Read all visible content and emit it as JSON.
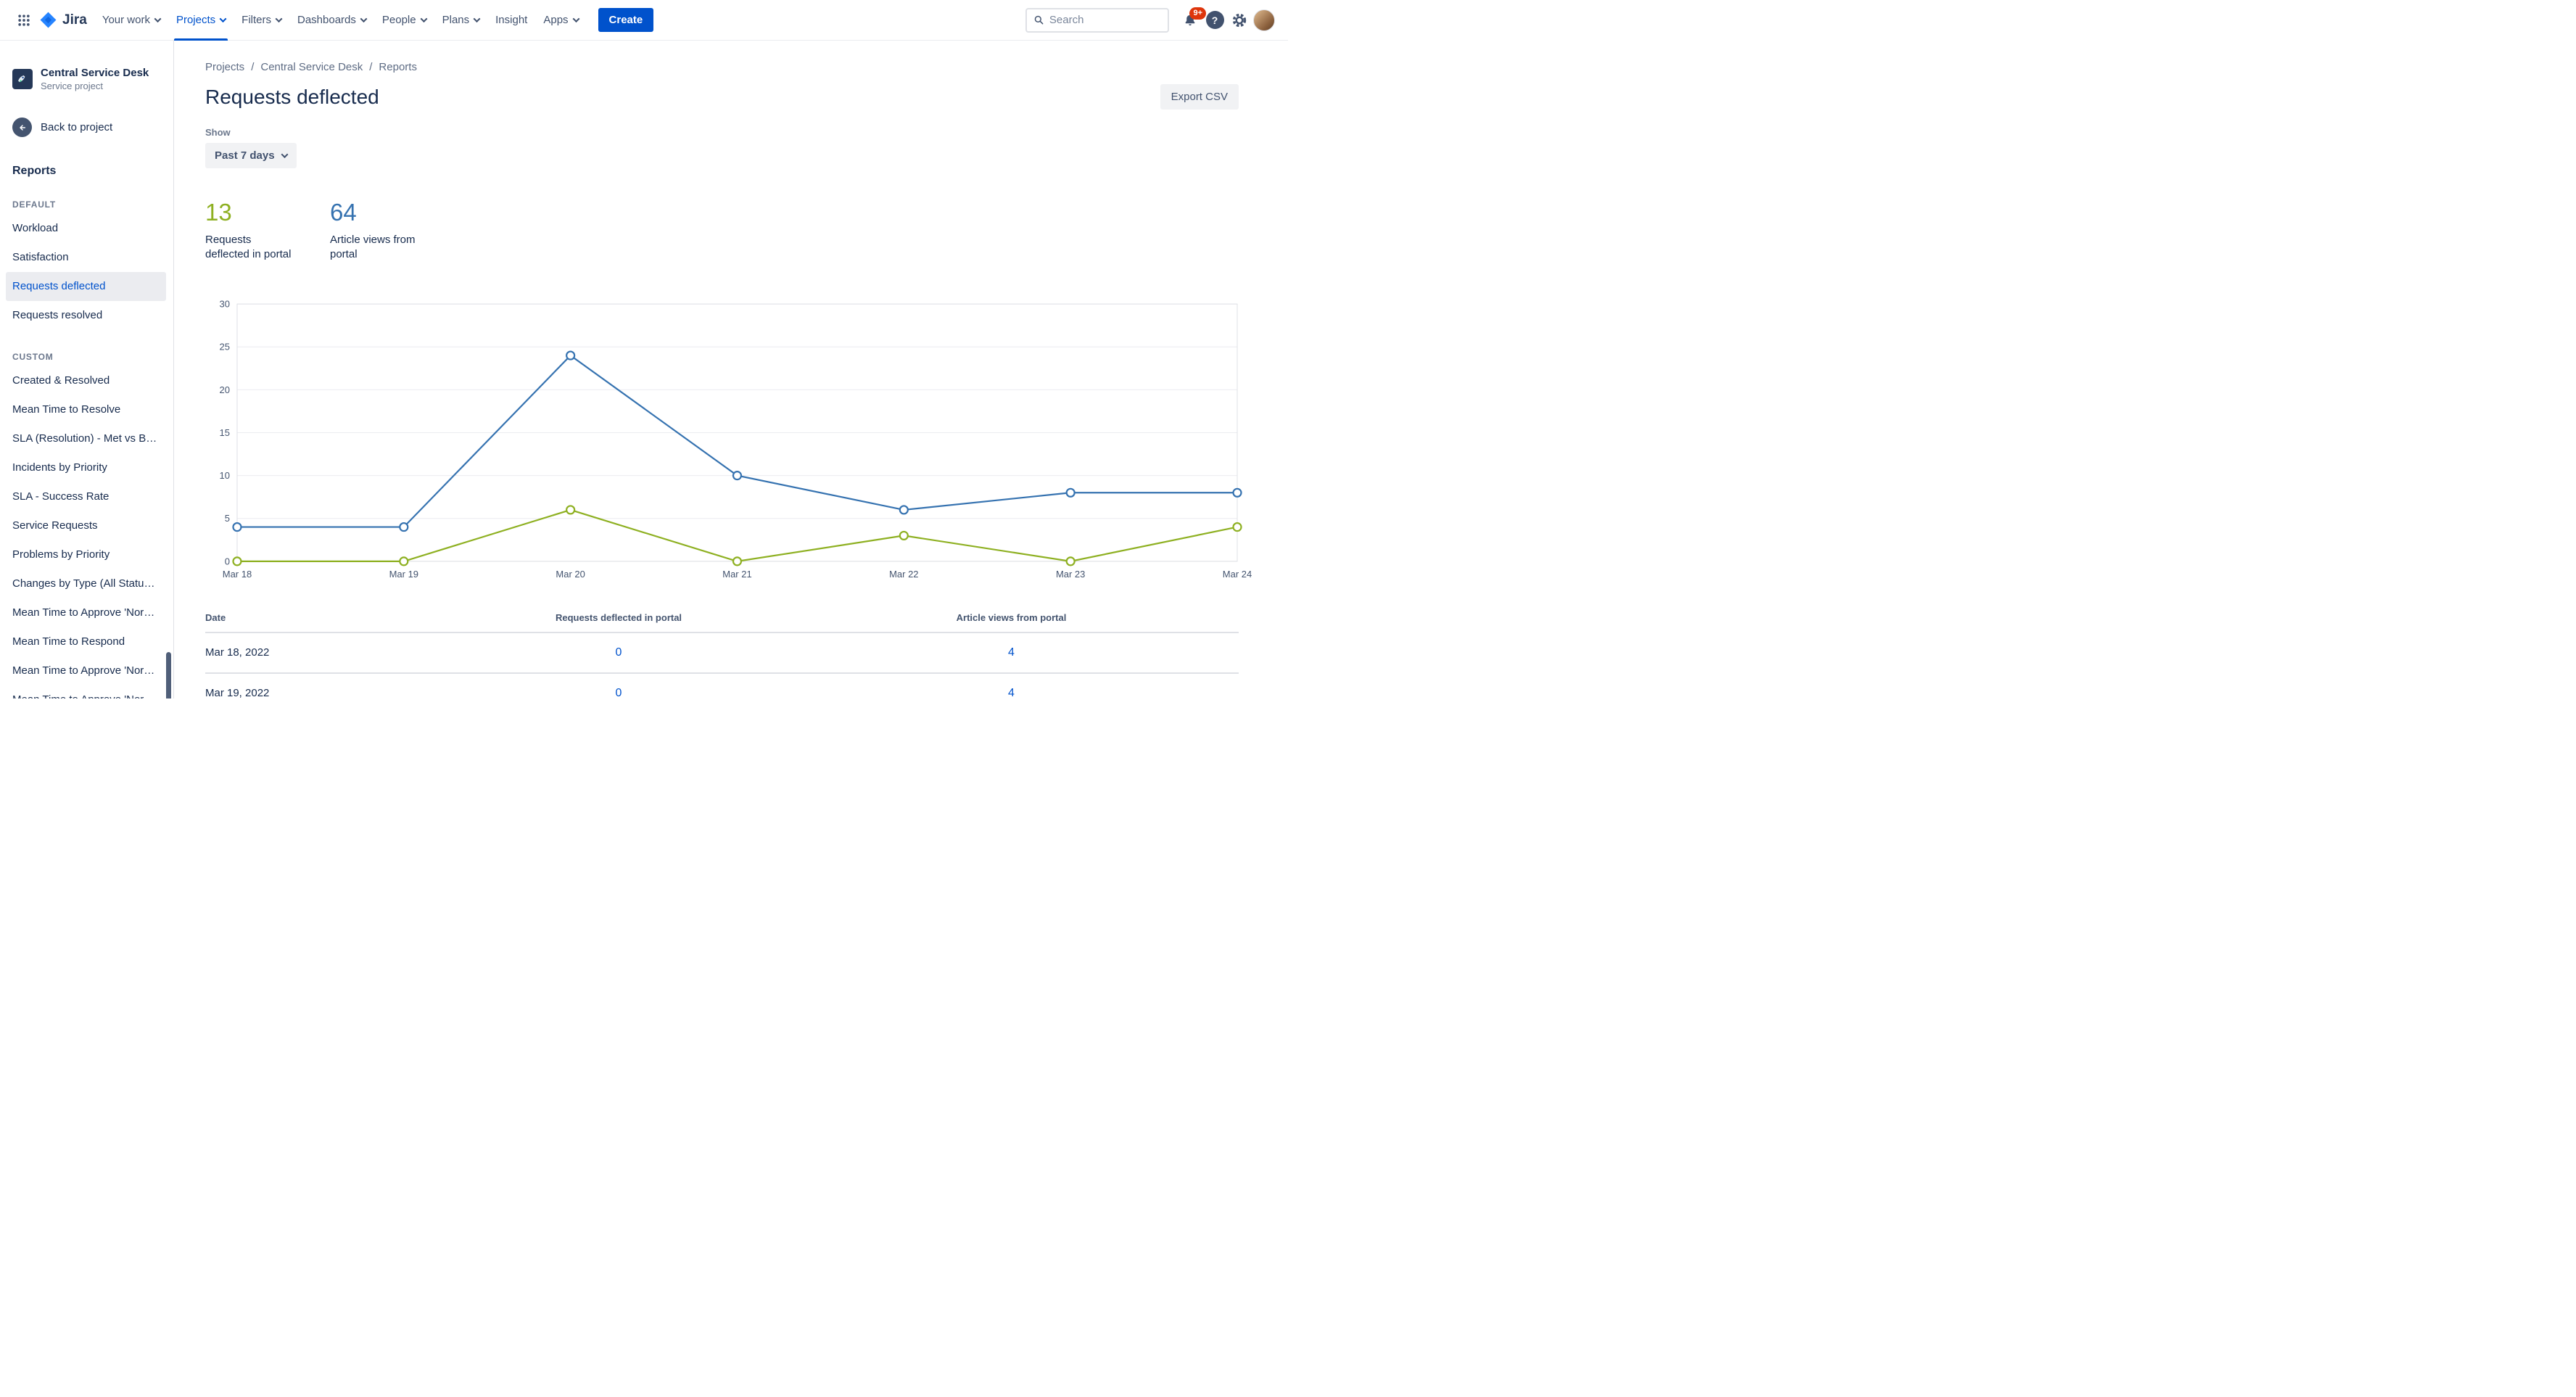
{
  "colors": {
    "link_blue": "#0052CC",
    "accent_green": "#8EB021",
    "accent_blue": "#3572B0",
    "badge_red": "#DE350B"
  },
  "topnav": {
    "brand": "Jira",
    "items": [
      {
        "label": "Your work"
      },
      {
        "label": "Projects"
      },
      {
        "label": "Filters"
      },
      {
        "label": "Dashboards"
      },
      {
        "label": "People"
      },
      {
        "label": "Plans"
      },
      {
        "label": "Insight"
      },
      {
        "label": "Apps"
      }
    ],
    "create_label": "Create",
    "search_placeholder": "Search",
    "notifications_badge": "9+"
  },
  "sidebar": {
    "project_name": "Central Service Desk",
    "project_type": "Service project",
    "back_label": "Back to project",
    "heading": "Reports",
    "groups": [
      {
        "title": "DEFAULT",
        "items": [
          "Workload",
          "Satisfaction",
          "Requests deflected",
          "Requests resolved"
        ]
      },
      {
        "title": "CUSTOM",
        "items": [
          "Created & Resolved",
          "Mean Time to Resolve",
          "SLA (Resolution) - Met vs Bre…",
          "Incidents by Priority",
          "SLA - Success Rate",
          "Service Requests",
          "Problems by Priority",
          "Changes by Type (All Statuses)",
          "Mean Time to Approve 'Norm…",
          "Mean Time to Respond",
          "Mean Time to Approve 'Norm…",
          "Mean Time to Approve 'Norm…"
        ]
      }
    ]
  },
  "breadcrumb": {
    "items": [
      "Projects",
      "Central Service Desk",
      "Reports"
    ],
    "separator": "/"
  },
  "page": {
    "title": "Requests deflected",
    "export_label": "Export CSV",
    "show_label": "Show",
    "range_value": "Past 7 days"
  },
  "stats": [
    {
      "value": "13",
      "label": "Requests deflected in portal",
      "color": "#8EB021"
    },
    {
      "value": "64",
      "label": "Article views from portal",
      "color": "#3572B0"
    }
  ],
  "chart_data": {
    "type": "line",
    "x": [
      "Mar 18",
      "Mar 19",
      "Mar 20",
      "Mar 21",
      "Mar 22",
      "Mar 23",
      "Mar 24"
    ],
    "series": [
      {
        "name": "Article views from portal",
        "color": "#3572B0",
        "values": [
          4,
          4,
          24,
          10,
          6,
          8,
          8
        ]
      },
      {
        "name": "Requests deflected in portal",
        "color": "#8EB021",
        "values": [
          0,
          0,
          6,
          0,
          3,
          0,
          4
        ]
      }
    ],
    "title": "",
    "xlabel": "",
    "ylabel": "",
    "ylim": [
      0,
      30
    ],
    "yticks": [
      0,
      5,
      10,
      15,
      20,
      25,
      30
    ],
    "grid": true,
    "legend": "none"
  },
  "table": {
    "headers": [
      "Date",
      "Requests deflected in portal",
      "Article views from portal"
    ],
    "rows": [
      [
        "Mar 18, 2022",
        "0",
        "4"
      ],
      [
        "Mar 19, 2022",
        "0",
        "4"
      ]
    ]
  }
}
